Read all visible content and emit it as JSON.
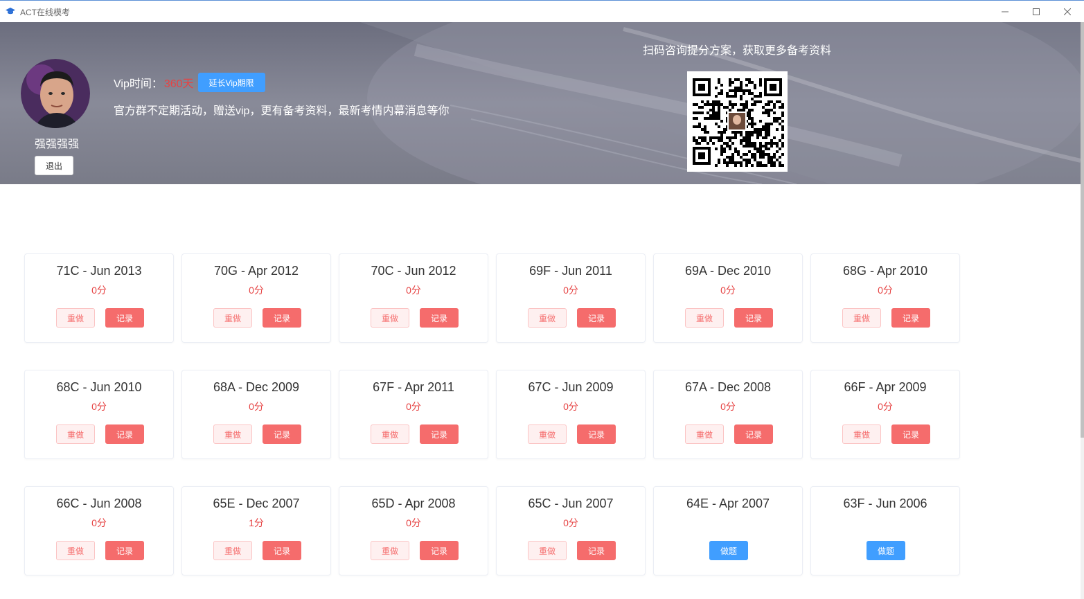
{
  "window": {
    "title": "ACT在线模考"
  },
  "header": {
    "username": "强强强强",
    "logout_label": "退出",
    "vip_label": "Vip时间：",
    "vip_value": "360天",
    "extend_label": "延长Vip期限",
    "notice": "官方群不定期活动，赠送vip，更有备考资料，最新考情内幕消息等你",
    "qr_caption": "扫码咨询提分方案，获取更多备考资料"
  },
  "buttons": {
    "redo": "重做",
    "record": "记录",
    "do": "做题"
  },
  "exams": [
    {
      "name": "71C - Jun 2013",
      "score": "0分",
      "status": "done"
    },
    {
      "name": "70G - Apr 2012",
      "score": "0分",
      "status": "done"
    },
    {
      "name": "70C - Jun 2012",
      "score": "0分",
      "status": "done"
    },
    {
      "name": "69F - Jun 2011",
      "score": "0分",
      "status": "done"
    },
    {
      "name": "69A - Dec 2010",
      "score": "0分",
      "status": "done"
    },
    {
      "name": "68G - Apr 2010",
      "score": "0分",
      "status": "done"
    },
    {
      "name": "68C - Jun 2010",
      "score": "0分",
      "status": "done"
    },
    {
      "name": "68A - Dec 2009",
      "score": "0分",
      "status": "done"
    },
    {
      "name": "67F - Apr 2011",
      "score": "0分",
      "status": "done"
    },
    {
      "name": "67C - Jun 2009",
      "score": "0分",
      "status": "done"
    },
    {
      "name": "67A - Dec 2008",
      "score": "0分",
      "status": "done"
    },
    {
      "name": "66F - Apr 2009",
      "score": "0分",
      "status": "done"
    },
    {
      "name": "66C - Jun 2008",
      "score": "0分",
      "status": "done"
    },
    {
      "name": "65E - Dec 2007",
      "score": "1分",
      "status": "done"
    },
    {
      "name": "65D - Apr 2008",
      "score": "0分",
      "status": "done"
    },
    {
      "name": "65C - Jun 2007",
      "score": "0分",
      "status": "done"
    },
    {
      "name": "64E - Apr 2007",
      "score": "",
      "status": "todo"
    },
    {
      "name": "63F - Jun 2006",
      "score": "",
      "status": "todo"
    }
  ],
  "colors": {
    "accent_blue": "#409eff",
    "danger_red": "#f56c6c",
    "score_red": "#e64343"
  }
}
